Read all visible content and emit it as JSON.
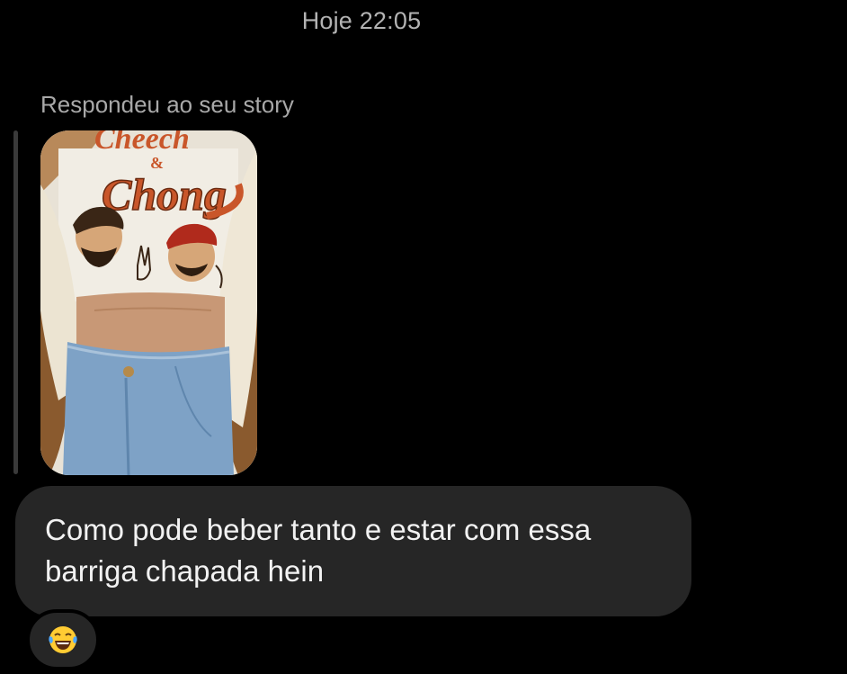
{
  "timestamp": "Hoje 22:05",
  "reply_label": "Respondeu ao seu story",
  "story": {
    "shirt_text_top": "Cheech",
    "shirt_text_amp": "&",
    "shirt_text_bottom": "Chong"
  },
  "message": {
    "text": "Como pode beber tanto e estar com essa barriga chapada hein"
  },
  "reaction": {
    "emoji": "😂",
    "icon": "laughing-tears-emoji-icon"
  },
  "colors": {
    "background": "#000000",
    "bubble": "#262626",
    "text": "#f2f2f2",
    "muted": "#a8a8a8"
  }
}
